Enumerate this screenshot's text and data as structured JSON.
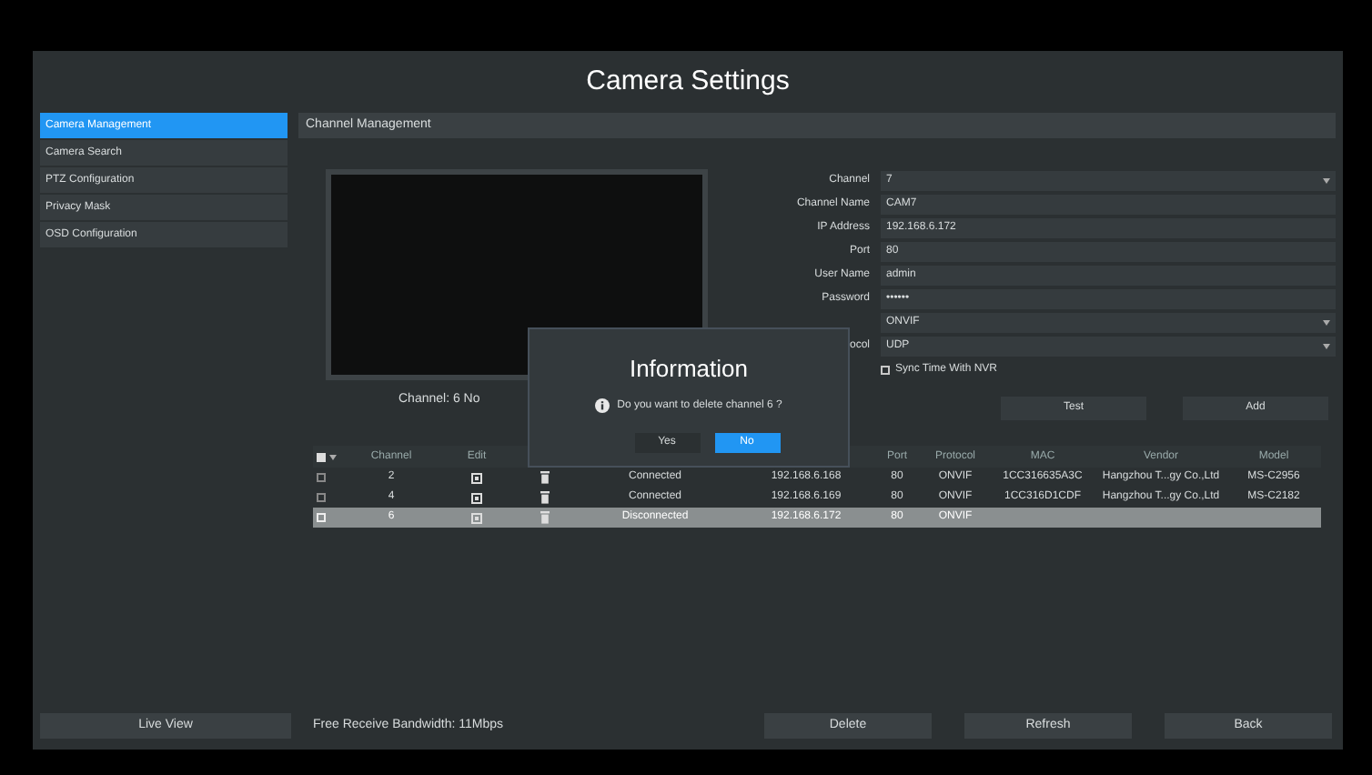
{
  "window": {
    "title": "Camera Settings"
  },
  "sidebar": {
    "items": [
      {
        "label": "Camera Management",
        "selected": true
      },
      {
        "label": "Camera Search",
        "selected": false
      },
      {
        "label": "PTZ Configuration",
        "selected": false
      },
      {
        "label": "Privacy Mask",
        "selected": false
      },
      {
        "label": "OSD Configuration",
        "selected": false
      }
    ]
  },
  "panel": {
    "title": "Channel Management",
    "preview_caption": "Channel: 6 No",
    "form": [
      {
        "label": "Channel",
        "value": "7",
        "kind": "dropdown"
      },
      {
        "label": "Channel Name",
        "value": "CAM7",
        "kind": "text"
      },
      {
        "label": "IP Address",
        "value": "192.168.6.172",
        "kind": "text"
      },
      {
        "label": "Port",
        "value": "80",
        "kind": "text"
      },
      {
        "label": "User Name",
        "value": "admin",
        "kind": "text"
      },
      {
        "label": "Password",
        "value": "••••••",
        "kind": "text"
      },
      {
        "value": "ONVIF",
        "kind": "dropdown"
      },
      {
        "label": "ocol",
        "value": "UDP",
        "kind": "dropdown"
      },
      {
        "label": "Sync Time With NVR",
        "kind": "checkbox",
        "checked": false
      }
    ],
    "buttons": [
      "Test",
      "Add"
    ]
  },
  "table": {
    "select_all_checked": true,
    "columns": [
      "Channel",
      "Edit",
      "Port",
      "Protocol",
      "MAC",
      "Vendor",
      "Model"
    ],
    "rows": [
      {
        "selected": false,
        "checked": false,
        "channel": "2",
        "status": "Connected",
        "ip": "192.168.6.168",
        "port": "80",
        "protocol": "ONVIF",
        "mac": "1CC316635A3C",
        "vendor": "Hangzhou T...gy Co.,Ltd",
        "model": "MS-C2956"
      },
      {
        "selected": false,
        "checked": false,
        "channel": "4",
        "status": "Connected",
        "ip": "192.168.6.169",
        "port": "80",
        "protocol": "ONVIF",
        "mac": "1CC316D1CDF",
        "vendor": "Hangzhou T...gy Co.,Ltd",
        "model": "MS-C2182"
      },
      {
        "selected": true,
        "checked": false,
        "channel": "6",
        "status": "Disconnected",
        "ip": "192.168.6.172",
        "port": "80",
        "protocol": "ONVIF"
      }
    ]
  },
  "dialog": {
    "title": "Information",
    "message": "Do you want to delete channel 6 ?",
    "buttons": [
      {
        "label": "Yes",
        "selected": false
      },
      {
        "label": "No",
        "selected": true
      }
    ]
  },
  "footer": {
    "live_view": "Live View",
    "bandwidth": "Free Receive Bandwidth: 11Mbps",
    "buttons": [
      "Delete",
      "Refresh",
      "Back"
    ]
  }
}
